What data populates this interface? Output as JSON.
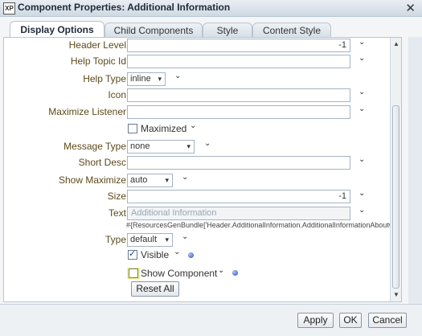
{
  "window": {
    "title": "Component Properties: Additional Information",
    "app_icon_text": "XP",
    "close_glyph": "✕"
  },
  "tabs": [
    {
      "label": "Display Options",
      "active": true
    },
    {
      "label": "Child Components",
      "active": false
    },
    {
      "label": "Style",
      "active": false
    },
    {
      "label": "Content Style",
      "active": false
    }
  ],
  "fields": {
    "header_level": {
      "label": "Header Level",
      "value": "-1"
    },
    "help_topic_id": {
      "label": "Help Topic Id",
      "value": ""
    },
    "help_type": {
      "label": "Help Type",
      "value": "inline"
    },
    "icon": {
      "label": "Icon",
      "value": ""
    },
    "maximize_listener": {
      "label": "Maximize Listener",
      "value": ""
    },
    "maximized": {
      "label": "Maximized",
      "checked": false
    },
    "message_type": {
      "label": "Message Type",
      "value": "none"
    },
    "short_desc": {
      "label": "Short Desc",
      "value": ""
    },
    "show_maximize": {
      "label": "Show Maximize",
      "value": "auto"
    },
    "size": {
      "label": "Size",
      "value": "-1"
    },
    "text": {
      "label": "Text",
      "value": "Additional Information",
      "el": "#{ResourcesGenBundle['Header.AdditionalInformation.AdditionalInformationAboutObje']}"
    },
    "type": {
      "label": "Type",
      "value": "default"
    },
    "visible": {
      "label": "Visible",
      "checked": true
    },
    "show_component": {
      "label": "Show Component",
      "checked": false
    }
  },
  "glyphs": {
    "chevron": "⌄",
    "dropdown_arrow": "▾",
    "check": "✓"
  },
  "buttons": {
    "reset_all": "Reset All",
    "apply": "Apply",
    "ok": "OK",
    "cancel": "Cancel"
  },
  "colors": {
    "label": "#5d4a1a",
    "highlight": "#f4f47a",
    "dot": "#2c4fb8"
  }
}
